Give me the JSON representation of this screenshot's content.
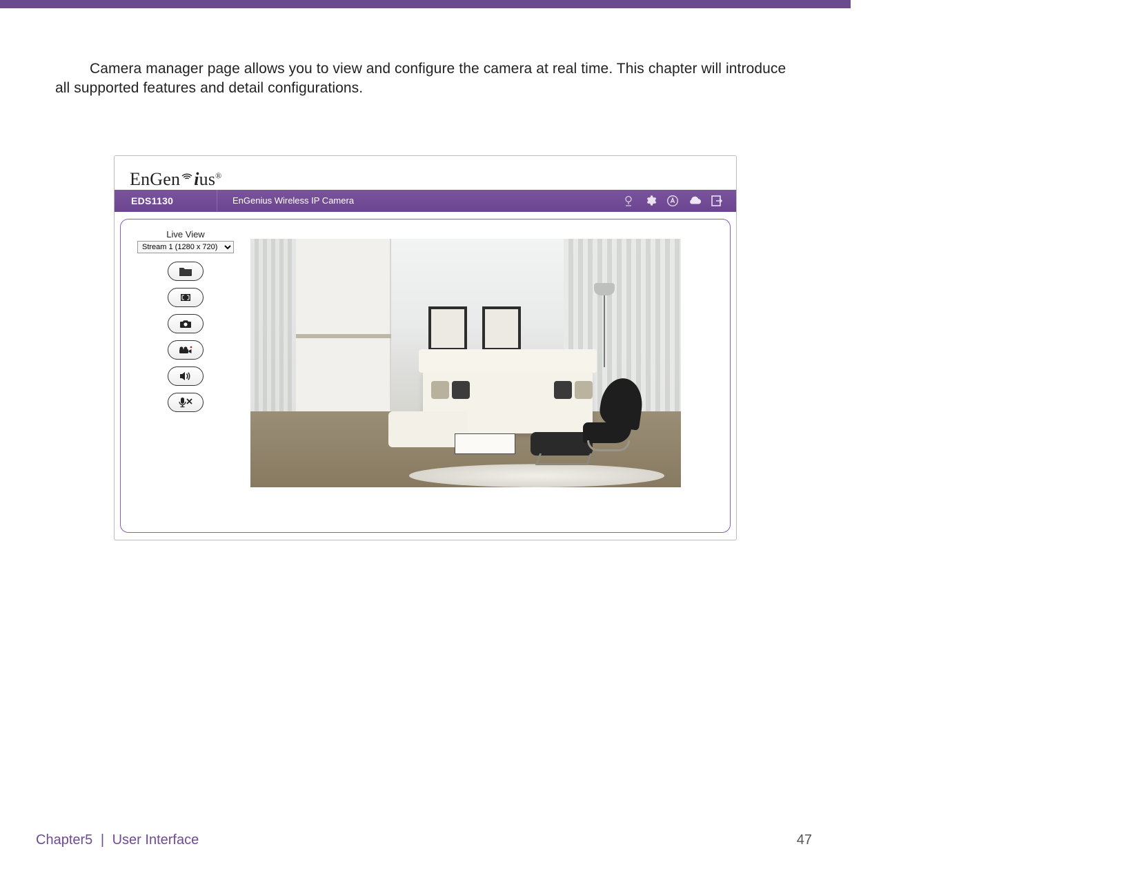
{
  "intro_paragraph": "Camera manager page allows you to view and configure the camera at real time. This chapter will introduce all supported features and detail configurations.",
  "screenshot": {
    "brand": {
      "pre": "EnGen",
      "i": "i",
      "post": "us",
      "registered": "®"
    },
    "toolbar": {
      "model": "EDS1130",
      "camera_name": "EnGenius Wireless IP Camera",
      "icons": [
        "camera-stand-icon",
        "gear-icon",
        "auto-a-icon",
        "cloud-icon",
        "logout-icon"
      ]
    },
    "side": {
      "title": "Live View",
      "stream_selected": "Stream 1 (1280 x 720)",
      "buttons": [
        {
          "name": "folder-button",
          "icon": "folder-icon"
        },
        {
          "name": "fullscreen-button",
          "icon": "fullscreen-icon"
        },
        {
          "name": "snapshot-button",
          "icon": "camera-icon"
        },
        {
          "name": "record-button",
          "icon": "camcorder-icon"
        },
        {
          "name": "speaker-button",
          "icon": "speaker-icon"
        },
        {
          "name": "mic-mute-button",
          "icon": "mic-mute-icon"
        }
      ]
    }
  },
  "footer": {
    "chapter": "Chapter5",
    "separator": "|",
    "title": "User Interface",
    "page": "47"
  }
}
